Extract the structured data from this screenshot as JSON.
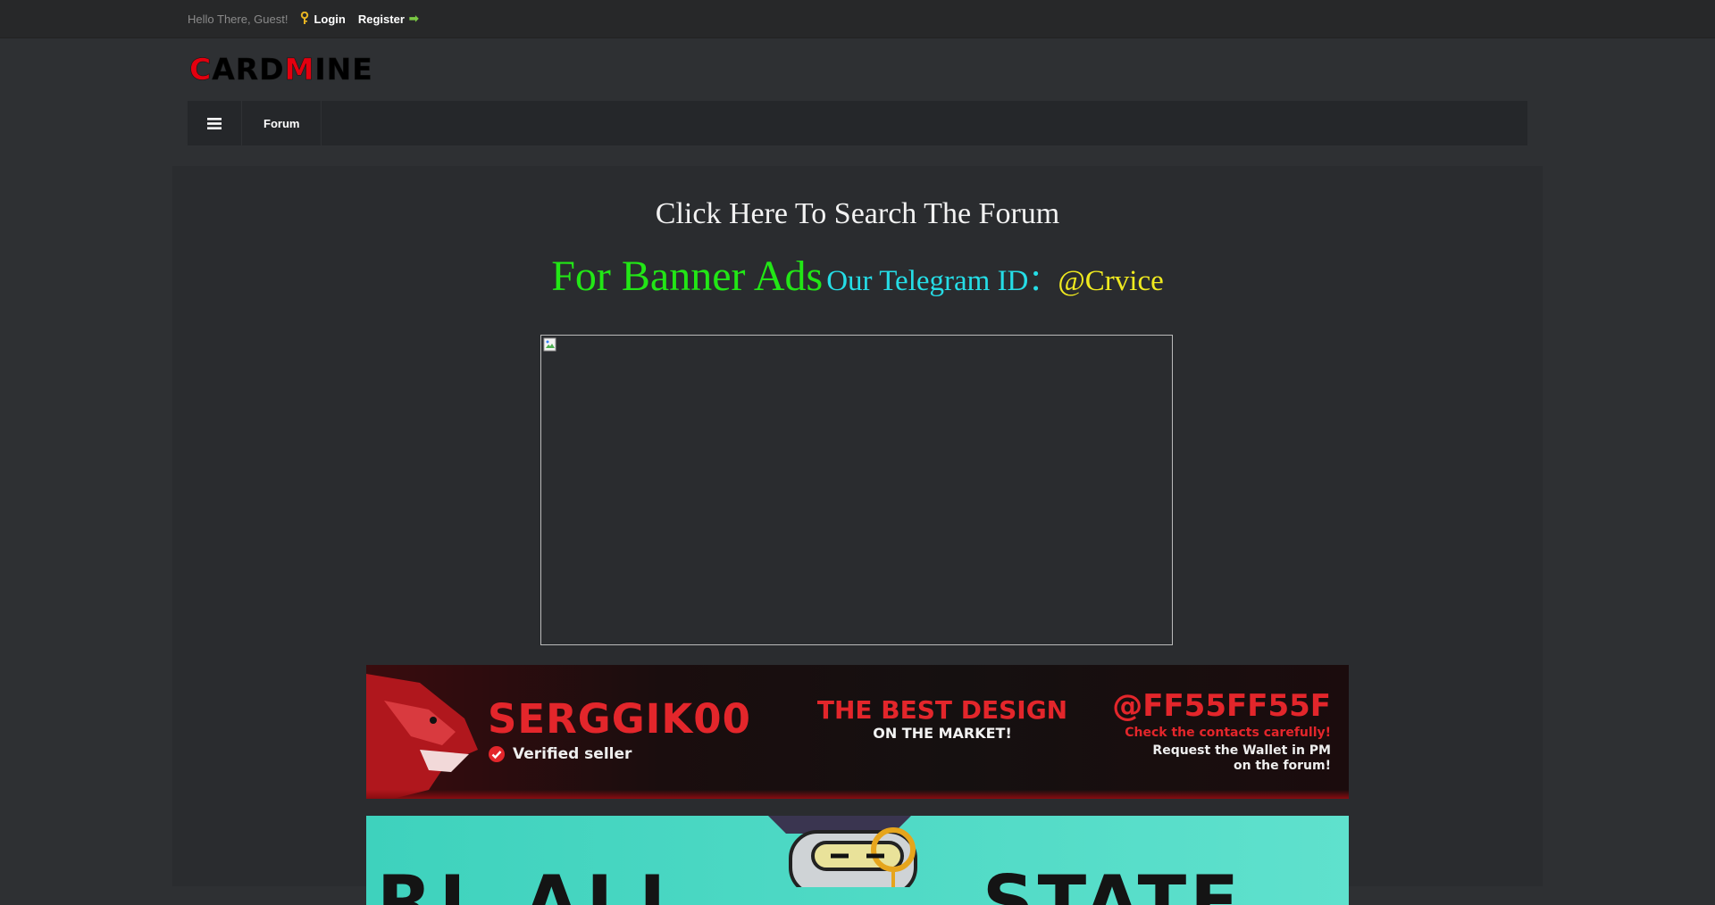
{
  "topbar": {
    "greeting": "Hello There, Guest!",
    "login_label": "Login",
    "register_label": "Register"
  },
  "logo": {
    "part1": "C",
    "part2": "ARD",
    "part3": "M",
    "part4": "INE"
  },
  "nav": {
    "menu_icon": "menu-icon",
    "forum_label": "Forum"
  },
  "main": {
    "search_link": "Click Here To Search The Forum",
    "ads": {
      "big": "For Banner Ads",
      "telegram": "Our Telegram ID：",
      "handle": "@Crvice"
    },
    "banner1": {
      "name": "SERGGIK00",
      "verified": "Verified seller",
      "best": "THE BEST DESIGN",
      "market": "ON THE MARKET!",
      "handle": "@FF55FF55F",
      "check": "Check the contacts carefully!",
      "request": "Request the Wallet in PM on the forum!"
    },
    "banner2": {
      "left": "RL ALL",
      "right": "STATE"
    }
  },
  "colors": {
    "ads_green": "#22e616",
    "ads_cyan": "#25dde6",
    "ads_yellow": "#f0ea1f",
    "logo_red": "#e3000f",
    "banner_red": "#e3262b"
  }
}
